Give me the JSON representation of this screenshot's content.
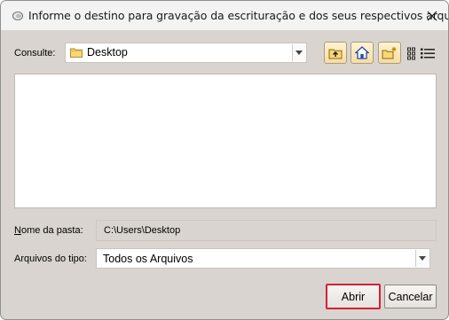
{
  "window": {
    "title": "Informe o destino para gravação da escrituração e dos seus respectivos arquivos",
    "close_icon": "close-icon"
  },
  "lookin": {
    "label_prefix": "Consulte:",
    "value": "Desktop",
    "folder_icon": "folder-icon"
  },
  "toolbar": {
    "icons": [
      "up-folder-icon",
      "home-icon",
      "new-folder-icon",
      "view-mode-icon"
    ]
  },
  "folder_name": {
    "label_underlined": "N",
    "label_rest": "ome da pasta:",
    "value": "C:\\Users\\Desktop"
  },
  "file_type": {
    "label": "Arquivos do tipo:",
    "value": "Todos os Arquivos"
  },
  "buttons": {
    "open": "Abrir",
    "cancel": "Cancelar"
  },
  "colors": {
    "dialog_bg": "#d9d4cf",
    "default_button_border": "#d32236",
    "toolbar_button": "#f6dca1"
  }
}
